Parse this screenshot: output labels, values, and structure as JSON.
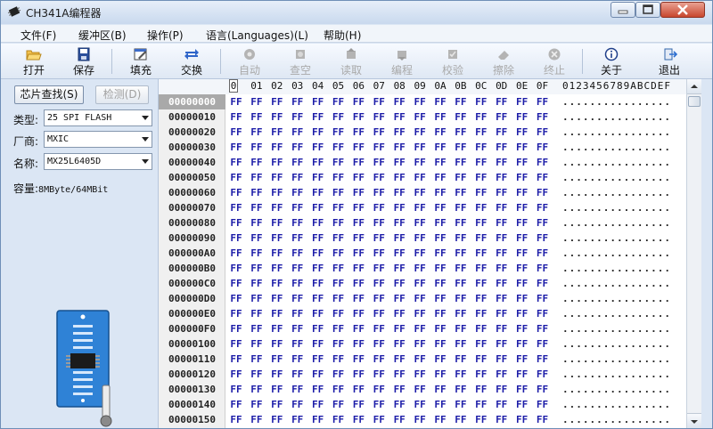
{
  "window": {
    "title": "CH341A编程器"
  },
  "menu": [
    {
      "label": "文件(F)"
    },
    {
      "label": "缓冲区(B)"
    },
    {
      "label": "操作(P)"
    },
    {
      "label": "语言(Languages)(L)"
    },
    {
      "label": "帮助(H)"
    }
  ],
  "toolbar": [
    {
      "label": "打开",
      "icon": "folder-open-icon",
      "enabled": true
    },
    {
      "label": "保存",
      "icon": "floppy-disk-icon",
      "enabled": true
    },
    {
      "label": "填充",
      "icon": "fill-edit-icon",
      "enabled": true
    },
    {
      "label": "交换",
      "icon": "swap-arrows-icon",
      "enabled": true
    },
    {
      "label": "自动",
      "icon": "auto-gear-icon",
      "enabled": false
    },
    {
      "label": "查空",
      "icon": "blank-check-icon",
      "enabled": false
    },
    {
      "label": "读取",
      "icon": "read-chip-icon",
      "enabled": false
    },
    {
      "label": "编程",
      "icon": "program-chip-icon",
      "enabled": false
    },
    {
      "label": "校验",
      "icon": "verify-chip-icon",
      "enabled": false
    },
    {
      "label": "擦除",
      "icon": "erase-chip-icon",
      "enabled": false
    },
    {
      "label": "终止",
      "icon": "stop-icon",
      "enabled": false
    },
    {
      "label": "关于",
      "icon": "info-icon",
      "enabled": true
    },
    {
      "label": "退出",
      "icon": "exit-door-icon",
      "enabled": true
    }
  ],
  "panel": {
    "find_chip_label": "芯片查找(S)",
    "detect_label": "检测(D)",
    "type_label": "类型:",
    "type_value": "25 SPI FLASH",
    "vendor_label": "厂商:",
    "vendor_value": "MXIC",
    "name_label": "名称:",
    "name_value": "MX25L6405D",
    "capacity_label": "容量:",
    "capacity_value": "8MByte/64MBit"
  },
  "hex": {
    "columns": [
      "0",
      "01",
      "02",
      "03",
      "04",
      "05",
      "06",
      "07",
      "08",
      "09",
      "0A",
      "0B",
      "0C",
      "0D",
      "0E",
      "0F"
    ],
    "ascii_header": "0123456789ABCDEF",
    "fill_byte": "FF",
    "ascii_fill": "................",
    "rows": [
      "00000000",
      "00000010",
      "00000020",
      "00000030",
      "00000040",
      "00000050",
      "00000060",
      "00000070",
      "00000080",
      "00000090",
      "000000A0",
      "000000B0",
      "000000C0",
      "000000D0",
      "000000E0",
      "000000F0",
      "00000100",
      "00000110",
      "00000120",
      "00000130",
      "00000140",
      "00000150"
    ],
    "selected_row": 0,
    "byte_color": "#1c1ca8"
  }
}
